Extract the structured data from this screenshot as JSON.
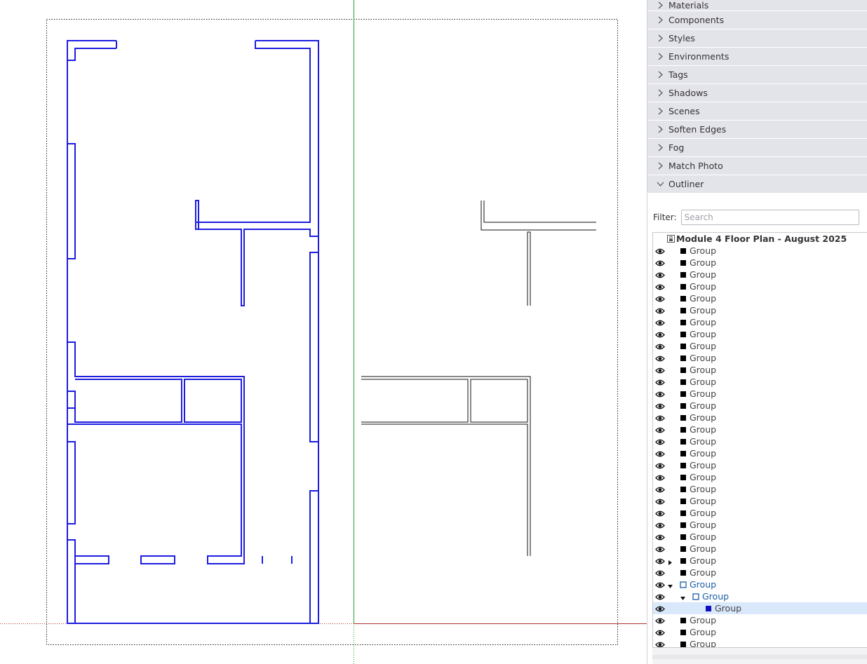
{
  "colors": {
    "plan_lines": "#1d1de0",
    "preview_lines": "#111111",
    "green_axis": "#2ca02c",
    "red_axis": "#b03030",
    "selection_bg": "#d9e8fb",
    "tray_header_bg": "#e3e3ea"
  },
  "tray": {
    "sections": [
      {
        "label": "Materials",
        "expanded": false
      },
      {
        "label": "Components",
        "expanded": false
      },
      {
        "label": "Styles",
        "expanded": false
      },
      {
        "label": "Environments",
        "expanded": false
      },
      {
        "label": "Tags",
        "expanded": false
      },
      {
        "label": "Shadows",
        "expanded": false
      },
      {
        "label": "Scenes",
        "expanded": false
      },
      {
        "label": "Soften Edges",
        "expanded": false
      },
      {
        "label": "Fog",
        "expanded": false
      },
      {
        "label": "Match Photo",
        "expanded": false
      },
      {
        "label": "Outliner",
        "expanded": true
      }
    ]
  },
  "outliner": {
    "filter_label": "Filter:",
    "filter_value": "",
    "filter_placeholder": "Search",
    "root_label": "Module 4 Floor Plan - August 2025",
    "rows": [
      {
        "label": "Group",
        "depth": 0,
        "toggle": "",
        "icon": "filled"
      },
      {
        "label": "Group",
        "depth": 0,
        "toggle": "",
        "icon": "filled"
      },
      {
        "label": "Group",
        "depth": 0,
        "toggle": "",
        "icon": "filled"
      },
      {
        "label": "Group",
        "depth": 0,
        "toggle": "",
        "icon": "filled"
      },
      {
        "label": "Group",
        "depth": 0,
        "toggle": "",
        "icon": "filled"
      },
      {
        "label": "Group",
        "depth": 0,
        "toggle": "",
        "icon": "filled"
      },
      {
        "label": "Group",
        "depth": 0,
        "toggle": "",
        "icon": "filled"
      },
      {
        "label": "Group",
        "depth": 0,
        "toggle": "",
        "icon": "filled"
      },
      {
        "label": "Group",
        "depth": 0,
        "toggle": "",
        "icon": "filled"
      },
      {
        "label": "Group",
        "depth": 0,
        "toggle": "",
        "icon": "filled"
      },
      {
        "label": "Group",
        "depth": 0,
        "toggle": "",
        "icon": "filled"
      },
      {
        "label": "Group",
        "depth": 0,
        "toggle": "",
        "icon": "filled"
      },
      {
        "label": "Group",
        "depth": 0,
        "toggle": "",
        "icon": "filled"
      },
      {
        "label": "Group",
        "depth": 0,
        "toggle": "",
        "icon": "filled"
      },
      {
        "label": "Group",
        "depth": 0,
        "toggle": "",
        "icon": "filled"
      },
      {
        "label": "Group",
        "depth": 0,
        "toggle": "",
        "icon": "filled"
      },
      {
        "label": "Group",
        "depth": 0,
        "toggle": "",
        "icon": "filled"
      },
      {
        "label": "Group",
        "depth": 0,
        "toggle": "",
        "icon": "filled"
      },
      {
        "label": "Group",
        "depth": 0,
        "toggle": "",
        "icon": "filled"
      },
      {
        "label": "Group",
        "depth": 0,
        "toggle": "",
        "icon": "filled"
      },
      {
        "label": "Group",
        "depth": 0,
        "toggle": "",
        "icon": "filled"
      },
      {
        "label": "Group",
        "depth": 0,
        "toggle": "",
        "icon": "filled"
      },
      {
        "label": "Group",
        "depth": 0,
        "toggle": "",
        "icon": "filled"
      },
      {
        "label": "Group",
        "depth": 0,
        "toggle": "",
        "icon": "filled"
      },
      {
        "label": "Group",
        "depth": 0,
        "toggle": "",
        "icon": "filled"
      },
      {
        "label": "Group",
        "depth": 0,
        "toggle": "",
        "icon": "filled"
      },
      {
        "label": "Group",
        "depth": 0,
        "toggle": "collapsed",
        "icon": "filled"
      },
      {
        "label": "Group",
        "depth": 0,
        "toggle": "",
        "icon": "filled"
      },
      {
        "label": "Group",
        "depth": 0,
        "toggle": "expanded",
        "icon": "open"
      },
      {
        "label": "Group",
        "depth": 1,
        "toggle": "expanded",
        "icon": "open"
      },
      {
        "label": "Group",
        "depth": 2,
        "toggle": "",
        "icon": "selected",
        "selected": true
      },
      {
        "label": "Group",
        "depth": 0,
        "toggle": "",
        "icon": "filled"
      },
      {
        "label": "Group",
        "depth": 0,
        "toggle": "",
        "icon": "filled"
      },
      {
        "label": "Group",
        "depth": 0,
        "toggle": "",
        "icon": "filled"
      }
    ]
  }
}
